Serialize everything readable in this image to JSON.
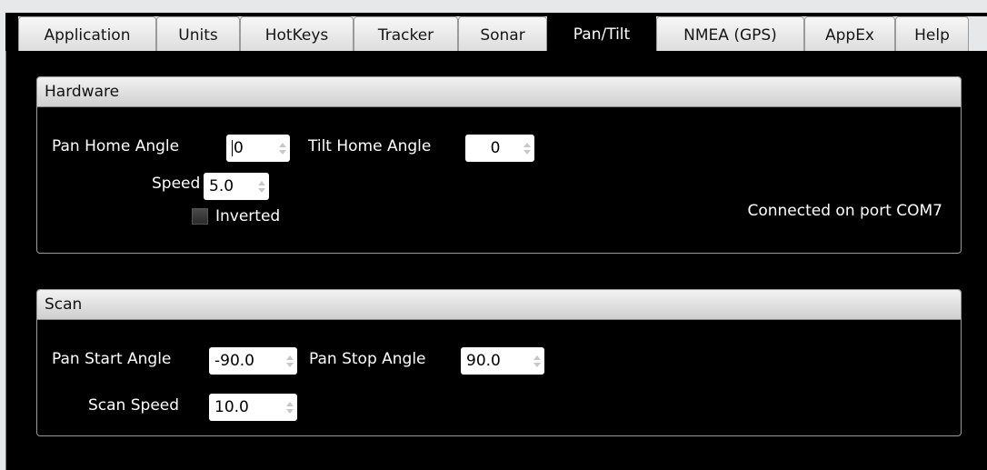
{
  "tabs": [
    {
      "label": "Application",
      "active": false
    },
    {
      "label": "Units",
      "active": false
    },
    {
      "label": "HotKeys",
      "active": false
    },
    {
      "label": "Tracker",
      "active": false
    },
    {
      "label": "Sonar",
      "active": false
    },
    {
      "label": "Pan/Tilt",
      "active": true
    },
    {
      "label": "NMEA (GPS)",
      "active": false
    },
    {
      "label": "AppEx",
      "active": false
    },
    {
      "label": "Help",
      "active": false
    }
  ],
  "hardware": {
    "title": "Hardware",
    "pan_home_label": "Pan Home Angle",
    "pan_home_value": "0",
    "tilt_home_label": "Tilt Home Angle",
    "tilt_home_value": "0",
    "speed_label": "Speed",
    "speed_value": "5.0",
    "inverted_label": "Inverted",
    "inverted_checked": false,
    "status": "Connected on port COM7"
  },
  "scan": {
    "title": "Scan",
    "pan_start_label": "Pan Start Angle",
    "pan_start_value": "-90.0",
    "pan_stop_label": "Pan Stop Angle",
    "pan_stop_value": "90.0",
    "scan_speed_label": "Scan Speed",
    "scan_speed_value": "10.0"
  },
  "colors": {
    "background": "#000000",
    "header_gradient_top": "#f2f2f2",
    "tab_active": "#000000"
  }
}
